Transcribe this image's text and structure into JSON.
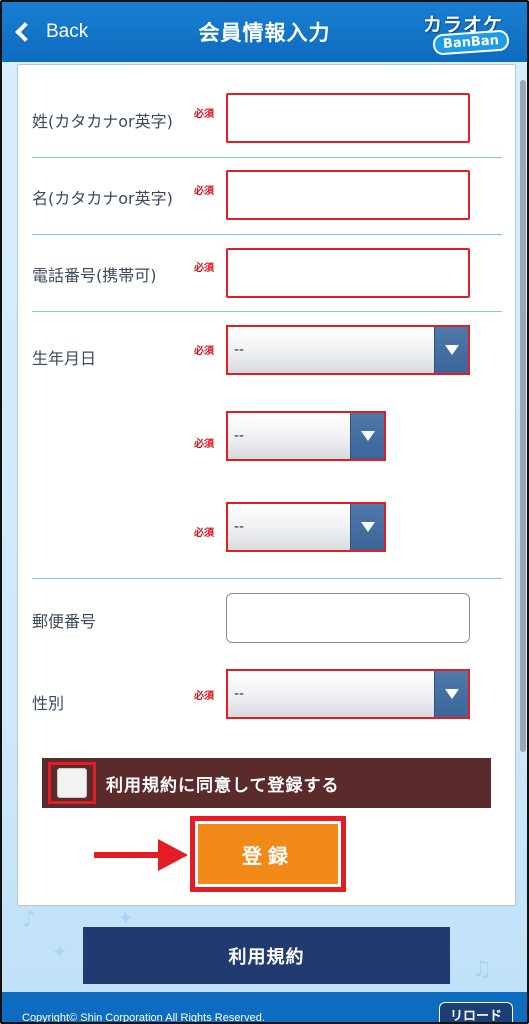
{
  "header": {
    "back_label": "Back",
    "title": "会員情報入力",
    "logo_line1": "カラオケ",
    "logo_line2": "BanBan"
  },
  "required_mark": "必須",
  "fields": {
    "last_name": {
      "label": "姓(カタカナor英字)",
      "value": ""
    },
    "first_name": {
      "label": "名(カタカナor英字)",
      "value": ""
    },
    "phone": {
      "label": "電話番号(携帯可)",
      "value": ""
    },
    "birthday": {
      "label": "生年月日",
      "year": "--",
      "month": "--",
      "day": "--"
    },
    "postal": {
      "label": "郵便番号",
      "value": ""
    },
    "gender": {
      "label": "性別",
      "value": "--"
    }
  },
  "agree_label": "利用規約に同意して登録する",
  "submit_label": "登録",
  "terms_label": "利用規約",
  "footer": {
    "copyright": "Copyright© Shin Corporation All Rights Reserved.",
    "reload_label": "リロード"
  },
  "colors": {
    "header_blue": "#0d6cc0",
    "required_red": "#d8121c",
    "submit_orange": "#f28a1a",
    "agree_bg": "#5b2a2a",
    "terms_navy": "#213a70"
  }
}
